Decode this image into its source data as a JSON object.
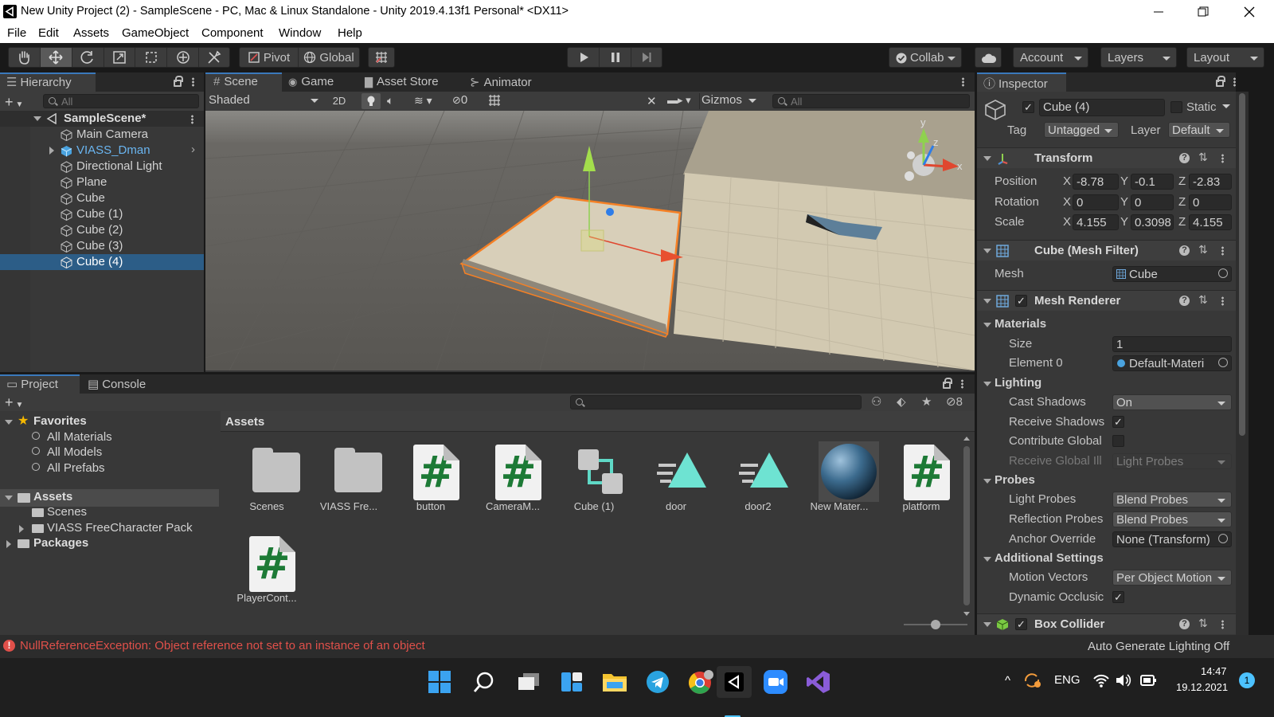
{
  "window": {
    "title": "New Unity Project (2) - SampleScene - PC, Mac & Linux Standalone - Unity 2019.4.13f1 Personal* <DX11>"
  },
  "menu": [
    "File",
    "Edit",
    "Assets",
    "GameObject",
    "Component",
    "Window",
    "Help"
  ],
  "toolbar": {
    "pivot": "Pivot",
    "global": "Global",
    "collab": "Collab",
    "account": "Account",
    "layers": "Layers",
    "layout": "Layout"
  },
  "hierarchy": {
    "title": "Hierarchy",
    "search_placeholder": "All",
    "scene": "SampleScene*",
    "items": [
      "Main Camera",
      "VIASS_Dman",
      "Directional Light",
      "Plane",
      "Cube",
      "Cube (1)",
      "Cube (2)",
      "Cube (3)",
      "Cube (4)"
    ],
    "selected": "Cube (4)"
  },
  "scene": {
    "tabs": [
      "Scene",
      "Game",
      "Asset Store",
      "Animator"
    ],
    "shading": "Shaded",
    "mode2d": "2D",
    "hidden_count": "0",
    "gizmos": "Gizmos",
    "search_placeholder": "All",
    "axes": [
      "y",
      "z",
      "x"
    ]
  },
  "inspector": {
    "title": "Inspector",
    "object_name": "Cube (4)",
    "static_label": "Static",
    "tag_label": "Tag",
    "tag_value": "Untagged",
    "layer_label": "Layer",
    "layer_value": "Default",
    "transform": {
      "name": "Transform",
      "position_label": "Position",
      "rotation_label": "Rotation",
      "scale_label": "Scale",
      "position": {
        "x": "-8.78",
        "y": "-0.1",
        "z": "-2.83"
      },
      "rotation": {
        "x": "0",
        "y": "0",
        "z": "0"
      },
      "scale": {
        "x": "4.155",
        "y": "0.3098",
        "z": "4.155"
      },
      "axis_x": "X",
      "axis_y": "Y",
      "axis_z": "Z"
    },
    "mesh_filter": {
      "name": "Cube (Mesh Filter)",
      "mesh_label": "Mesh",
      "mesh_value": "Cube"
    },
    "mesh_renderer": {
      "name": "Mesh Renderer",
      "materials": "Materials",
      "size_label": "Size",
      "size_value": "1",
      "element0_label": "Element 0",
      "element0_value": "Default-Materi",
      "lighting": "Lighting",
      "cast_shadows_label": "Cast Shadows",
      "cast_shadows_value": "On",
      "receive_shadows_label": "Receive Shadows",
      "contribute_gi_label": "Contribute Global",
      "receive_gi_label": "Receive Global Ill",
      "receive_gi_value": "Light Probes",
      "probes": "Probes",
      "light_probes_label": "Light Probes",
      "light_probes_value": "Blend Probes",
      "reflection_probes_label": "Reflection Probes",
      "reflection_probes_value": "Blend Probes",
      "anchor_override_label": "Anchor Override",
      "anchor_override_value": "None (Transform)",
      "additional": "Additional Settings",
      "motion_vectors_label": "Motion Vectors",
      "motion_vectors_value": "Per Object Motion",
      "dynamic_occlusion_label": "Dynamic Occlusic"
    },
    "box_collider": {
      "name": "Box Collider"
    }
  },
  "project": {
    "tabs": [
      "Project",
      "Console"
    ],
    "favorites": "Favorites",
    "fav_items": [
      "All Materials",
      "All Models",
      "All Prefabs"
    ],
    "assets_root": "Assets",
    "asset_folders": [
      "Scenes",
      "VIASS FreeCharacter Pack"
    ],
    "packages": "Packages",
    "breadcrumb": "Assets",
    "hidden_count": "8",
    "assets": [
      {
        "name": "Scenes",
        "type": "folder"
      },
      {
        "name": "VIASS Fre...",
        "type": "folder"
      },
      {
        "name": "button",
        "type": "script"
      },
      {
        "name": "CameraM...",
        "type": "script"
      },
      {
        "name": "Cube (1)",
        "type": "prefab"
      },
      {
        "name": "door",
        "type": "anim"
      },
      {
        "name": "door2",
        "type": "anim"
      },
      {
        "name": "New Mater...",
        "type": "material"
      },
      {
        "name": "platform",
        "type": "script"
      },
      {
        "name": "PlayerCont...",
        "type": "script"
      }
    ]
  },
  "status": {
    "error": "NullReferenceException: Object reference not set to an instance of an object",
    "lighting": "Auto Generate Lighting Off"
  },
  "taskbar": {
    "language": "ENG",
    "time": "14:47",
    "date": "19.12.2021",
    "notifications": "1"
  },
  "colors": {
    "selection": "#2c5d87",
    "error": "#e0504a",
    "accent": "#3a79bb"
  }
}
